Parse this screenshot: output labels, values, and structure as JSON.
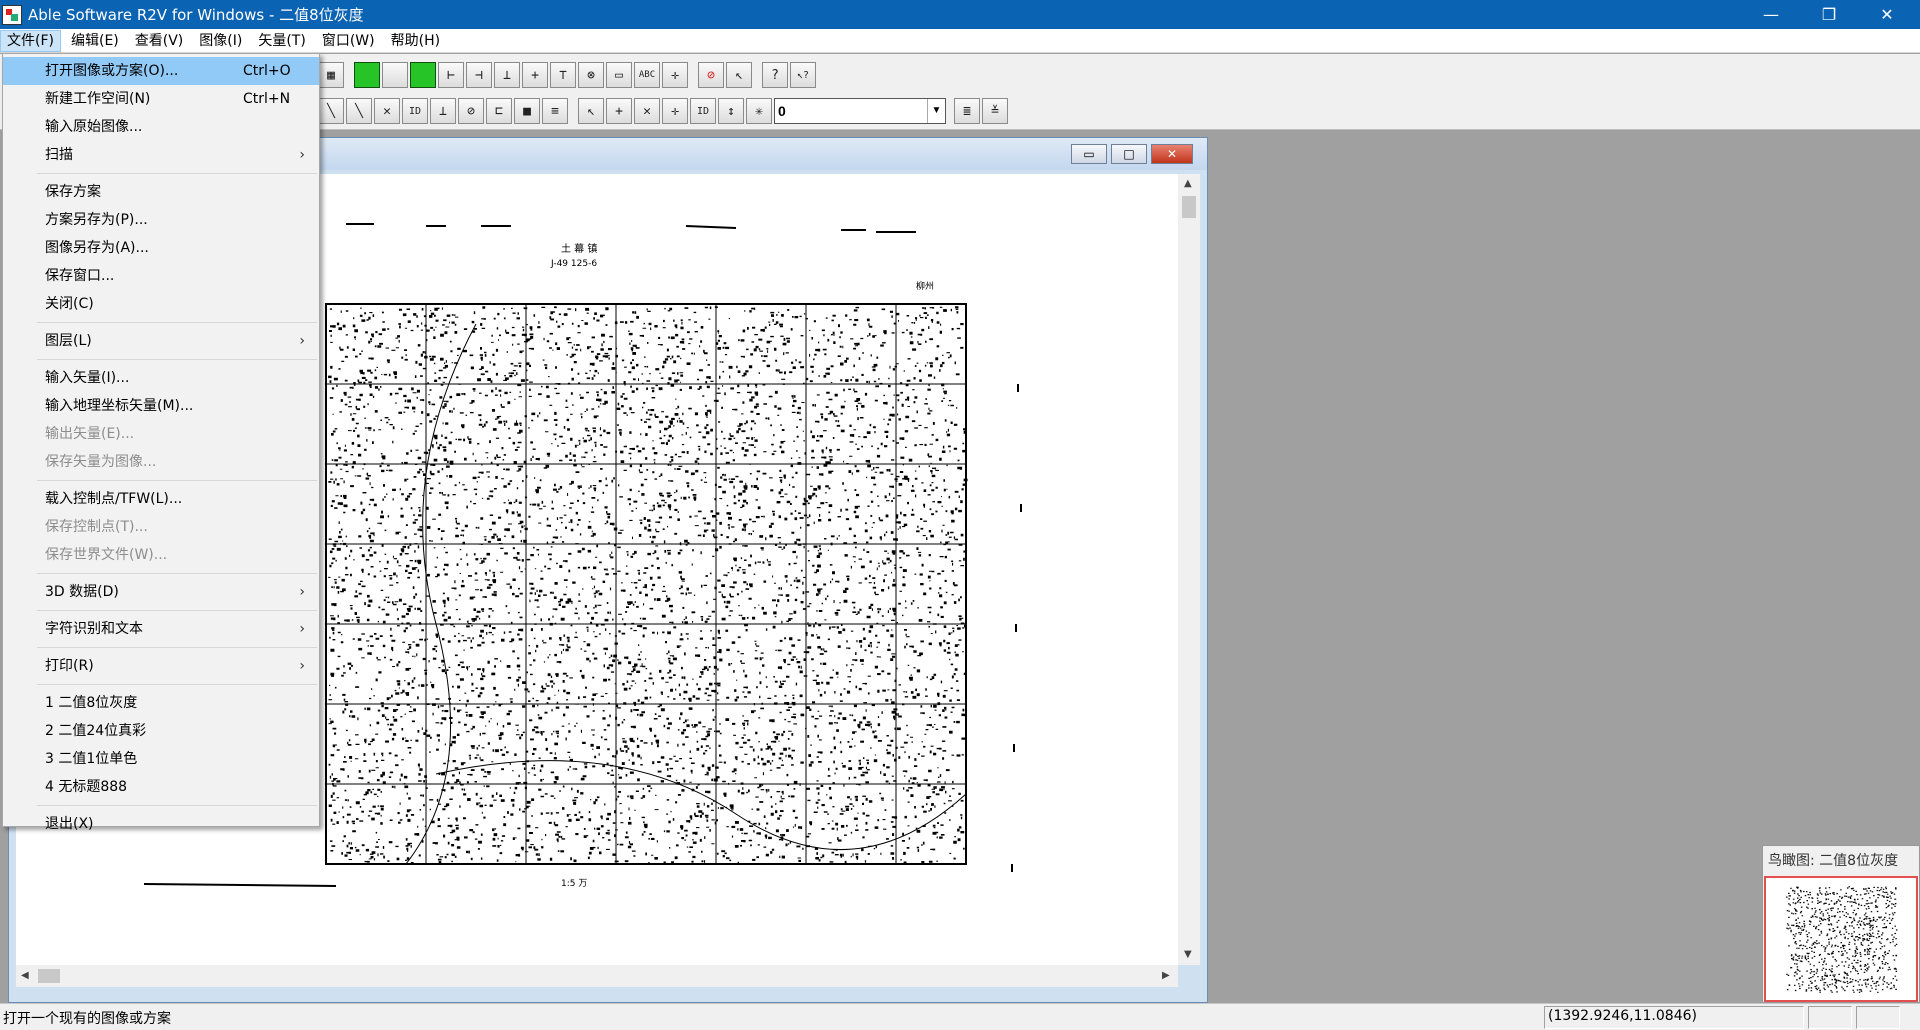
{
  "window": {
    "title": "Able Software R2V for Windows - 二值8位灰度",
    "minimize_glyph": "—",
    "maximize_glyph": "❐",
    "close_glyph": "✕"
  },
  "menubar": {
    "items": [
      {
        "label": "文件(F)"
      },
      {
        "label": "编辑(E)"
      },
      {
        "label": "查看(V)"
      },
      {
        "label": "图像(I)"
      },
      {
        "label": "矢量(T)"
      },
      {
        "label": "窗口(W)"
      },
      {
        "label": "帮助(H)"
      }
    ]
  },
  "file_menu": {
    "group1": [
      {
        "label": "打开图像或方案(O)...",
        "shortcut": "Ctrl+O",
        "highlighted": true
      },
      {
        "label": "新建工作空间(N)",
        "shortcut": "Ctrl+N"
      },
      {
        "label": "输入原始图像..."
      },
      {
        "label": "扫描",
        "submenu": "›"
      }
    ],
    "group2": [
      {
        "label": "保存方案"
      },
      {
        "label": "方案另存为(P)..."
      },
      {
        "label": "图像另存为(A)..."
      },
      {
        "label": "保存窗口..."
      },
      {
        "label": "关闭(C)"
      }
    ],
    "group3": [
      {
        "label": "图层(L)",
        "submenu": "›"
      }
    ],
    "group4": [
      {
        "label": "输入矢量(I)..."
      },
      {
        "label": "输入地理坐标矢量(M)..."
      },
      {
        "label": "输出矢量(E)...",
        "disabled": true
      },
      {
        "label": "保存矢量为图像...",
        "disabled": true
      }
    ],
    "group5": [
      {
        "label": "载入控制点/TFW(L)..."
      },
      {
        "label": "保存控制点(T)...",
        "disabled": true
      },
      {
        "label": "保存世界文件(W)...",
        "disabled": true
      }
    ],
    "group6": [
      {
        "label": "3D 数据(D)",
        "submenu": "›"
      }
    ],
    "group7": [
      {
        "label": "字符识别和文本",
        "submenu": "›"
      }
    ],
    "group8": [
      {
        "label": "打印(R)",
        "submenu": "›"
      }
    ],
    "recent": [
      {
        "label": "1 二值8位灰度"
      },
      {
        "label": "2 二值24位真彩"
      },
      {
        "label": "3 二值1位单色"
      },
      {
        "label": "4 无标题888"
      }
    ],
    "exit": {
      "label": "退出(X)"
    }
  },
  "toolbar": {
    "row1": [
      "▦",
      "",
      "",
      "⊢",
      "⊣",
      "⊥",
      "+",
      "⊤",
      "⊗",
      "▭",
      "ABC",
      "✛",
      "⊘",
      "↖",
      "?",
      "↖?"
    ],
    "row2": [
      "╲",
      "╲",
      "✕",
      "ID",
      "⊥",
      "⊘",
      "⊏",
      "■",
      "≡",
      "↖",
      "+",
      "✕",
      "✛",
      "ID",
      "↕",
      "✳"
    ],
    "layer_combo_value": "0",
    "combo_arrow": "▼",
    "extra_buttons": [
      "≣",
      "≚"
    ]
  },
  "child_window": {
    "min_glyph": "▭",
    "max_glyph": "□",
    "close_glyph": "✕",
    "map_title": "土 幕 镇",
    "map_subtitle": "J-49 125-6",
    "map_corner_label": "柳州",
    "map_bottom_label": "1:5 万",
    "scroll_up": "▲",
    "scroll_down": "▼",
    "scroll_left": "◀",
    "scroll_right": "▶"
  },
  "birdseye": {
    "title": "鸟瞰图: 二值8位灰度"
  },
  "statusbar": {
    "message": "打开一个现有的图像或方案",
    "coordinates": "(1392.9246,11.0846)"
  },
  "colors": {
    "titlebar": "#0b63b4",
    "menu_highlight": "#91c9f7",
    "workspace": "#a0a0a0"
  }
}
